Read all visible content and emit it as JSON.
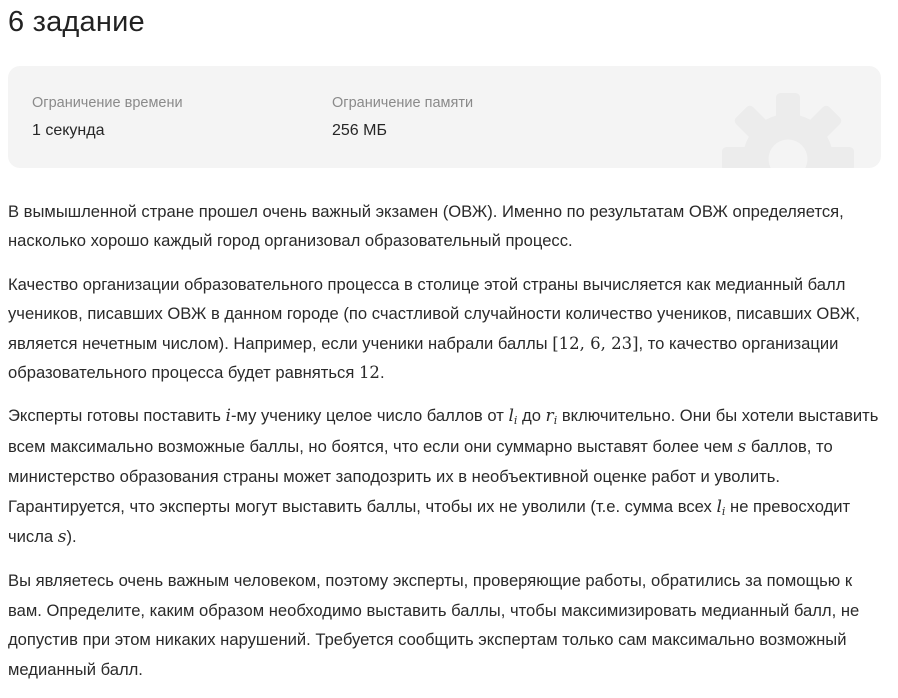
{
  "title": "6 задание",
  "limits": {
    "time_label": "Ограничение времени",
    "time_value": "1 секунда",
    "memory_label": "Ограничение памяти",
    "memory_value": "256 МБ",
    "decor_icon": "gear-icon",
    "card_bg": "#f4f4f4"
  },
  "statement": {
    "p1": "В вымышленной стране прошел очень важный экзамен (ОВЖ). Именно по результатам ОВЖ определяется, насколько хорошо каждый город организовал образовательный процесс.",
    "p2": {
      "a": "Качество организации образовательного процесса в столице этой страны вычисляется как медианный балл учеников, писавших ОВЖ в данном городе (по счастливой случайности количество учеников, писавших ОВЖ, является нечетным числом). Например, если ученики набрали баллы ",
      "m1": "[12, 6, 23]",
      "b": ", то качество организации образовательного процесса будет равняться ",
      "m2": "12",
      "c": "."
    },
    "p3": {
      "a": "Эксперты готовы поставить ",
      "m_i": "i",
      "b": "-му ученику целое число баллов от ",
      "m_l": "l",
      "m_l_sub": "i",
      "c": " до ",
      "m_r": "r",
      "m_r_sub": "i",
      "d": " включительно. Они бы хотели выставить всем максимально возможные баллы, но боятся, что если они суммарно выставят более чем ",
      "m_s1": "s",
      "e": " баллов, то министерство образования страны может заподозрить их в необъективной оценке работ и уволить. Гарантируется, что эксперты могут выставить баллы, чтобы их не уволили (т.е. сумма всех ",
      "m_l2": "l",
      "m_l2_sub": "i",
      "f": " не превосходит числа ",
      "m_s2": "s",
      "g": ")."
    },
    "p4": "Вы являетесь очень важным человеком, поэтому эксперты, проверяющие работы, обратились за помощью к вам. Определите, каким образом необходимо выставить баллы, чтобы максимизировать медианный балл, не допустив при этом никаких нарушений. Требуется сообщить экспертам только сам максимально возможный медианный балл."
  }
}
